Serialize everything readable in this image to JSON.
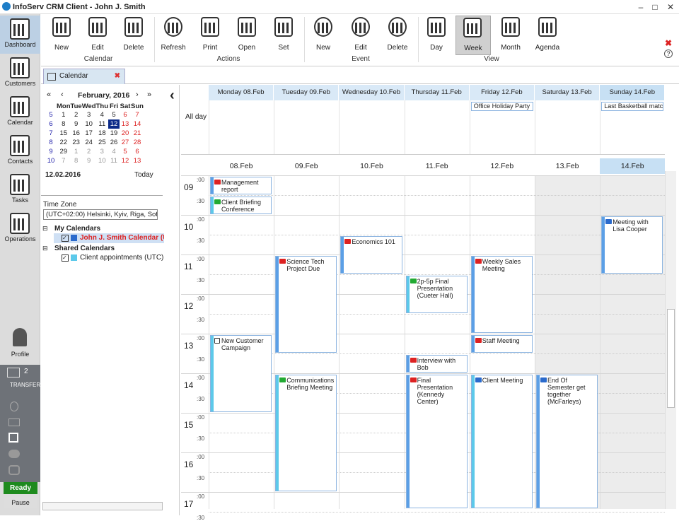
{
  "title": "InfoServ CRM Client - John J. Smith",
  "nav": {
    "items": [
      {
        "label": "Dashboard"
      },
      {
        "label": "Customers"
      },
      {
        "label": "Calendar"
      },
      {
        "label": "Contacts"
      },
      {
        "label": "Tasks"
      },
      {
        "label": "Operations"
      },
      {
        "label": "Profile"
      }
    ],
    "transfer": "TRANSFER",
    "transfer_count": "2",
    "ready": "Ready",
    "pause": "Pause"
  },
  "ribbon": {
    "calendar": {
      "new": "New",
      "edit": "Edit",
      "delete": "Delete",
      "group": "Calendar"
    },
    "actions": {
      "refresh": "Refresh",
      "print": "Print",
      "open": "Open",
      "set": "Set",
      "group": "Actions"
    },
    "event": {
      "new": "New",
      "edit": "Edit",
      "delete": "Delete",
      "group": "Event"
    },
    "view": {
      "day": "Day",
      "week": "Week",
      "month": "Month",
      "agenda": "Agenda",
      "group": "View"
    }
  },
  "tab": {
    "label": "Calendar"
  },
  "mini": {
    "month": "February, 2016",
    "dows": [
      "Mon",
      "Tue",
      "Wed",
      "Thu",
      "Fri",
      "Sat",
      "Sun"
    ],
    "weeks": [
      [
        "5",
        "1",
        "2",
        "3",
        "4",
        "5",
        "6",
        "7"
      ],
      [
        "6",
        "8",
        "9",
        "10",
        "11",
        "12",
        "13",
        "14"
      ],
      [
        "7",
        "15",
        "16",
        "17",
        "18",
        "19",
        "20",
        "21"
      ],
      [
        "8",
        "22",
        "23",
        "24",
        "25",
        "26",
        "27",
        "28"
      ],
      [
        "9",
        "29",
        "1",
        "2",
        "3",
        "4",
        "5",
        "6"
      ],
      [
        "10",
        "7",
        "8",
        "9",
        "10",
        "11",
        "12",
        "13"
      ]
    ],
    "date": "12.02.2016",
    "today": "Today"
  },
  "tz": {
    "label": "Time Zone",
    "value": "(UTC+02:00) Helsinki, Kyiv, Riga, Sofi"
  },
  "calendars": {
    "my": "My Calendars",
    "my_item": "John J. Smith Calendar (UTC-",
    "shared": "Shared Calendars",
    "shared_item": "Client appointments (UTC) Du"
  },
  "week": {
    "headers": [
      "Monday 08.Feb",
      "Tuesday 09.Feb",
      "Wednesday 10.Feb",
      "Thursday 11.Feb",
      "Friday 12.Feb",
      "Saturday 13.Feb",
      "Sunday 14.Feb"
    ],
    "short": [
      "08.Feb",
      "09.Feb",
      "10.Feb",
      "11.Feb",
      "12.Feb",
      "13.Feb",
      "14.Feb"
    ],
    "allday": "All day",
    "allday_events": [
      {
        "day": 4,
        "title": "Office Holiday Party"
      },
      {
        "day": 6,
        "title": "Last Basketball match"
      }
    ],
    "hours": [
      "09",
      "10",
      "11",
      "12",
      "13",
      "14",
      "15",
      "16",
      "17"
    ],
    "min00": ":00",
    "min30": ":30"
  },
  "events": [
    {
      "title": "Management report",
      "color": "red"
    },
    {
      "title": "Client Briefing Conference",
      "color": "green"
    },
    {
      "title": "Economics 101",
      "color": "red"
    },
    {
      "title": "Meeting with Lisa Cooper",
      "color": "blue"
    },
    {
      "title": "Science Tech Project Due",
      "color": "red"
    },
    {
      "title": "Weekly Sales Meeting",
      "color": "red"
    },
    {
      "title": "2p-5p Final Presentation (Cueter Hall)",
      "color": "green"
    },
    {
      "title": "New Customer Campaign",
      "color": "none"
    },
    {
      "title": "Staff Meeting",
      "color": "red"
    },
    {
      "title": "Interview with Bob",
      "color": "red"
    },
    {
      "title": "Communications Briefing Meeting",
      "color": "green"
    },
    {
      "title": "Final Presentation (Kennedy Center)",
      "color": "red"
    },
    {
      "title": "Client Meeting",
      "color": "blue"
    },
    {
      "title": "End Of Semester get together (McFarleys)",
      "color": "blue"
    }
  ]
}
